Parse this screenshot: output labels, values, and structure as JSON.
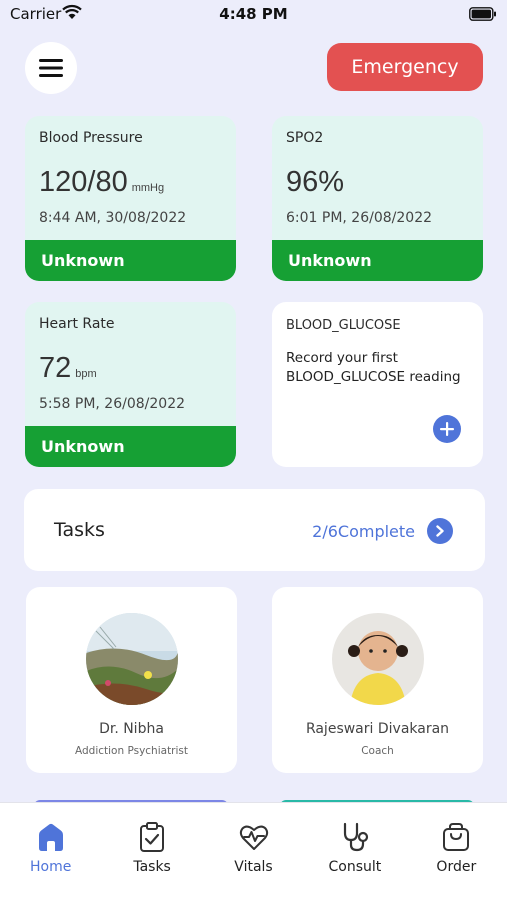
{
  "status_bar": {
    "carrier": "Carrier",
    "time": "4:48 PM"
  },
  "header": {
    "menu_icon": "hamburger-menu-icon",
    "emergency_label": "Emergency",
    "emergency_color": "#e35151"
  },
  "vitals": {
    "blood_pressure": {
      "title": "Blood Pressure",
      "value": "120/80",
      "unit": "mmHg",
      "time": "8:44 AM, 30/08/2022",
      "status": "Unknown"
    },
    "spo2": {
      "title": "SPO2",
      "value": "96%",
      "unit": "",
      "time": "6:01 PM, 26/08/2022",
      "status": "Unknown"
    },
    "heart_rate": {
      "title": "Heart Rate",
      "value": "72",
      "unit": "bpm",
      "time": "5:58 PM, 26/08/2022",
      "status": "Unknown"
    },
    "blood_glucose": {
      "title": "BLOOD_GLUCOSE",
      "message": "Record your first BLOOD_GLUCOSE reading",
      "add_icon": "plus-icon"
    },
    "status_color": "#16a034",
    "card_color": "#e1f5f1"
  },
  "tasks": {
    "title": "Tasks",
    "progress": "2/6Complete",
    "arrow_icon": "chevron-right-icon"
  },
  "care_team": [
    {
      "name": "Dr. Nibha",
      "role": "Addiction Psychiatrist"
    },
    {
      "name": "Rajeswari Divakaran",
      "role": "Coach"
    }
  ],
  "tab_bar": {
    "items": [
      {
        "label": "Home",
        "icon": "home-icon",
        "active": true
      },
      {
        "label": "Tasks",
        "icon": "clipboard-check-icon",
        "active": false
      },
      {
        "label": "Vitals",
        "icon": "heart-pulse-icon",
        "active": false
      },
      {
        "label": "Consult",
        "icon": "stethoscope-icon",
        "active": false
      },
      {
        "label": "Order",
        "icon": "shopping-bag-icon",
        "active": false
      }
    ],
    "accent_color": "#4f74d9"
  }
}
